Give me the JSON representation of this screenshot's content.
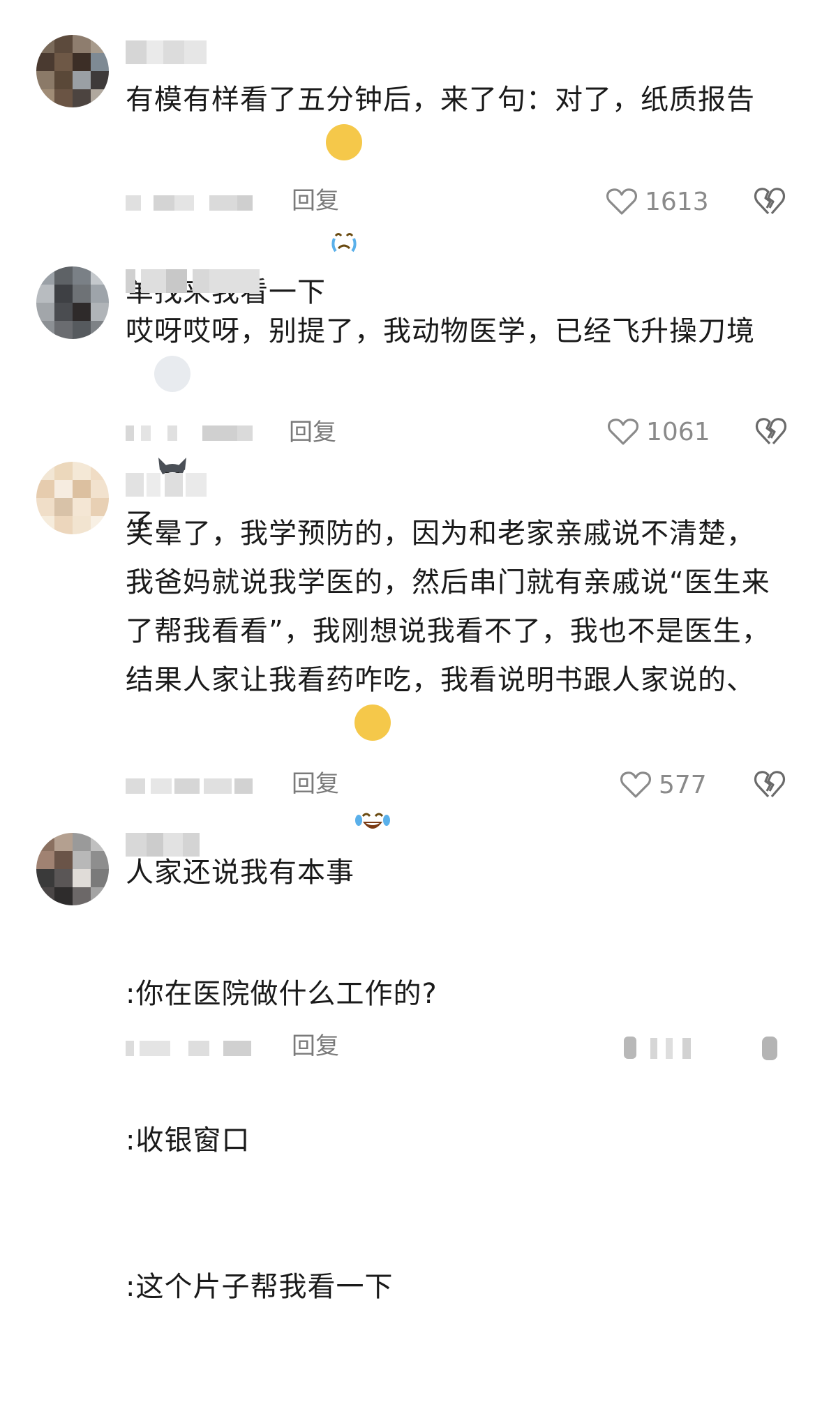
{
  "reply_label": "回复",
  "comments": [
    {
      "text": "有模有样看了五分钟后，来了句：对了，纸质报告单找来我看一下",
      "emoji": "crying-face-emoji",
      "likes": "1613"
    },
    {
      "text": "哎呀哎呀，别提了，我动物医学，已经飞升操刀境了",
      "emoji": "husky-dog-emoji",
      "likes": "1061"
    },
    {
      "text": "笑晕了，我学预防的，因为和老家亲戚说不清楚，我爸妈就说我学医的，然后串门就有亲戚说“医生来了帮我看看”，我刚想说我看不了，我也不是医生，结果人家让我看药咋吃，我看说明书跟人家说的、人家还说我有本事",
      "emoji": "tears-of-joy-emoji",
      "likes": "577"
    },
    {
      "lines": [
        ":你在医院做什么工作的?",
        ":收银窗口",
        ":这个片子帮我看一下"
      ],
      "likes": ""
    }
  ],
  "colors": {
    "text": "#1a1a1a",
    "meta": "#8a8a8a",
    "blur": "#d9d9d9"
  }
}
